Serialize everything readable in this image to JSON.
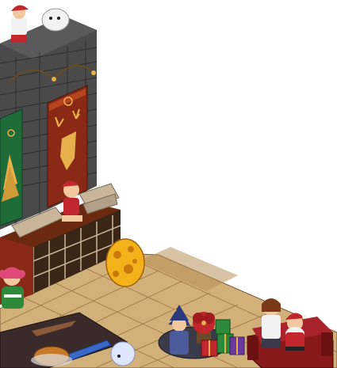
{
  "scene": {
    "background": "#ffffff",
    "floor_light": "#d2b07a",
    "floor_dark": "#b88f5a",
    "floor_edge": "#7a5630",
    "wall_stone": "#4a4a4a",
    "wall_stone_dark": "#2e2e2e",
    "banner_green": "#1f6b3a",
    "banner_red": "#8a2a16",
    "banner_gold": "#e8b04a",
    "fireplace_frame": "#6b2a10",
    "fireplace_grate": "#3a2616",
    "firewood": "#c9b59a",
    "egg_yellow": "#f4b21a",
    "egg_spot": "#c7790b",
    "sofa_red": "#8a1a1a",
    "table_dark": "#3a2a2a",
    "gift_green": "#2d8a3a",
    "gift_red": "#c2272d",
    "gift_purple": "#6a3aa0"
  },
  "objects": [
    {
      "name": "stone-tower"
    },
    {
      "name": "deer-banner"
    },
    {
      "name": "tree-banner"
    },
    {
      "name": "brick-fireplace"
    },
    {
      "name": "firewood-pile"
    },
    {
      "name": "golden-spotted-egg"
    },
    {
      "name": "wooden-tile-floor"
    },
    {
      "name": "christmas-sofa"
    },
    {
      "name": "gift-box-stack"
    },
    {
      "name": "poinsettia-plant"
    },
    {
      "name": "dining-table"
    },
    {
      "name": "roast-turkey"
    },
    {
      "name": "fluffy-white-pet"
    }
  ],
  "avatars": [
    {
      "name": "elf-avatar-on-tower"
    },
    {
      "name": "elf-avatar-by-fireplace"
    },
    {
      "name": "pink-haired-avatar"
    },
    {
      "name": "wizard-avatar"
    },
    {
      "name": "santa-avatar"
    },
    {
      "name": "brown-haired-avatar-on-sofa"
    },
    {
      "name": "white-haired-avatar"
    }
  ]
}
